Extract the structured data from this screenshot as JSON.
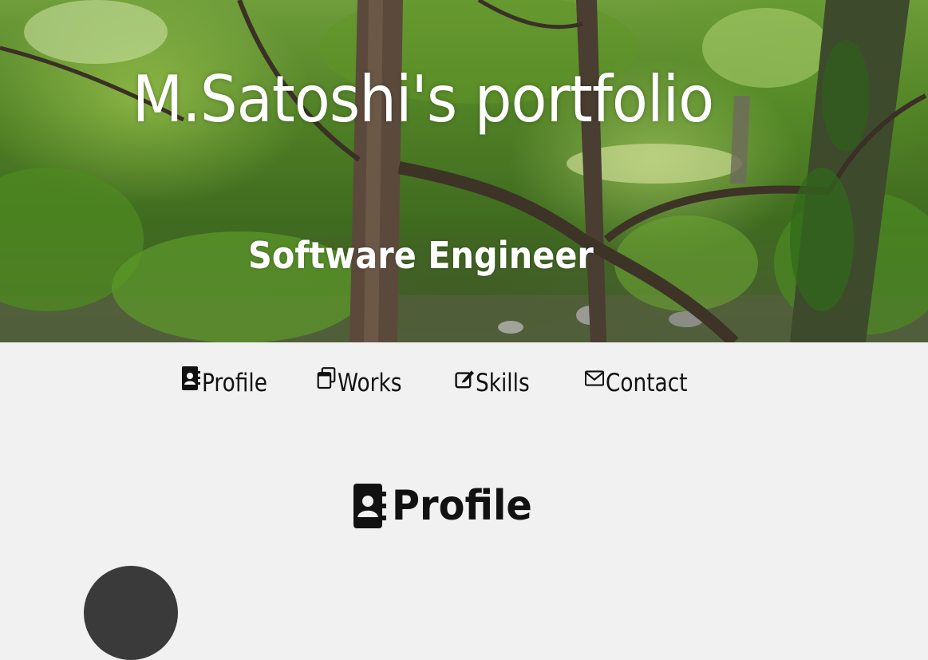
{
  "hero": {
    "title": "M.Satoshi's portfolio",
    "subtitle": "Software Engineer"
  },
  "nav": {
    "items": [
      {
        "label": "Profile",
        "icon": "contact-book-icon"
      },
      {
        "label": "Works",
        "icon": "copy-windows-icon"
      },
      {
        "label": "Skills",
        "icon": "pen-to-square-icon"
      },
      {
        "label": "Contact",
        "icon": "envelope-icon"
      }
    ]
  },
  "profile_section": {
    "title": "Profile",
    "icon": "contact-book-icon"
  },
  "colors": {
    "page_background": "#f1f1f1",
    "text": "#111111",
    "hero_text": "#ffffff"
  }
}
